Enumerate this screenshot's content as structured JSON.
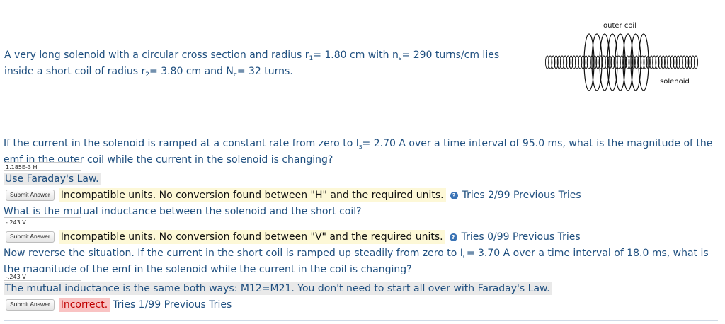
{
  "problem": {
    "intro": {
      "a": "A very long solenoid with a circular cross section and radius r",
      "a_sub": "1",
      "b": "= 1.80 cm with n",
      "b_sub": "s",
      "c": "= 290 turns/cm lies inside a short coil of radius r",
      "c_sub": "2",
      "d": "= 3.80 cm and N",
      "d_sub": "c",
      "e": "= 32 turns."
    },
    "figure": {
      "outer_label": "outer coil",
      "inner_label": "solenoid"
    },
    "q1": {
      "a": "If the current in the solenoid is ramped at a constant rate from zero to I",
      "a_sub": "s",
      "b": "= 2.70 A over a time interval of 95.0 ms, what is the magnitude of the emf in the outer coil while the current in the solenoid is changing?",
      "answer": "1.185E-3 H",
      "hint": "Use Faraday's Law.",
      "submit": "Submit Answer",
      "feedback": "Incompatible units. No conversion found between \"H\" and the required units.",
      "tries": "Tries 2/99 Previous Tries"
    },
    "q2": {
      "text": "What is the mutual inductance between the solenoid and the short coil?",
      "answer": "-.243 V",
      "submit": "Submit Answer",
      "feedback": "Incompatible units. No conversion found between \"V\" and the required units.",
      "tries": "Tries 0/99 Previous Tries"
    },
    "q3": {
      "a": "Now reverse the situation. If the current in the short coil is ramped up steadily from zero to I",
      "a_sub": "c",
      "b": "= 3.70 A over a time interval of 18.0 ms, what is the magnitude of the emf in the solenoid while the current in the coil is changing?",
      "answer": "-.243 V",
      "hint": "The mutual inductance is the same both ways: M12=M21. You don't need to start all over with Faraday's Law.",
      "submit": "Submit Answer",
      "feedback": "Incorrect.",
      "tries": "Tries 1/99 Previous Tries"
    }
  },
  "colors": {
    "text": "#1f4f7f",
    "feedback_bg": "#fdf8d7",
    "incorrect_bg": "#f9c3c3",
    "incorrect_text": "#c00000"
  },
  "icons": {
    "help": "help-circle-icon"
  }
}
